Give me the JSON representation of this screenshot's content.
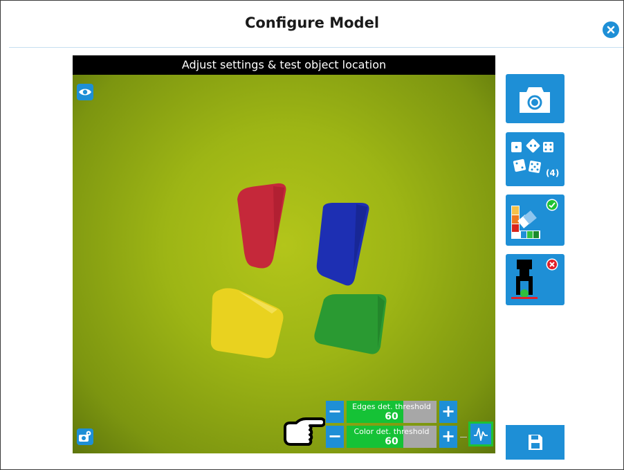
{
  "dialog": {
    "title": "Configure Model"
  },
  "camera": {
    "caption": "Adjust settings & test object location"
  },
  "thresholds": {
    "edges": {
      "label": "Edges det. threshold",
      "value": "60",
      "minus": "−",
      "plus": "+",
      "fill_fraction": 0.63
    },
    "color": {
      "label": "Color det. threshold",
      "value": "60",
      "minus": "−",
      "plus": "+",
      "fill_fraction": 0.63
    }
  },
  "sidebar": {
    "models_count": "(4)",
    "color_status": "ok",
    "gripper_status": "error"
  },
  "icons": [
    "close-icon",
    "eye-icon",
    "camera-settings-icon",
    "pointing-hand-icon",
    "waveform-icon",
    "camera-icon",
    "dice-icon",
    "color-palette-icon",
    "gripper-icon",
    "check-icon",
    "error-icon",
    "save-icon"
  ],
  "colors": {
    "accent": "#1e8fd6",
    "slider_fill": "#15c236",
    "slider_track": "#a7a7a7",
    "ok": "#1ec234",
    "error": "#e0202a"
  }
}
